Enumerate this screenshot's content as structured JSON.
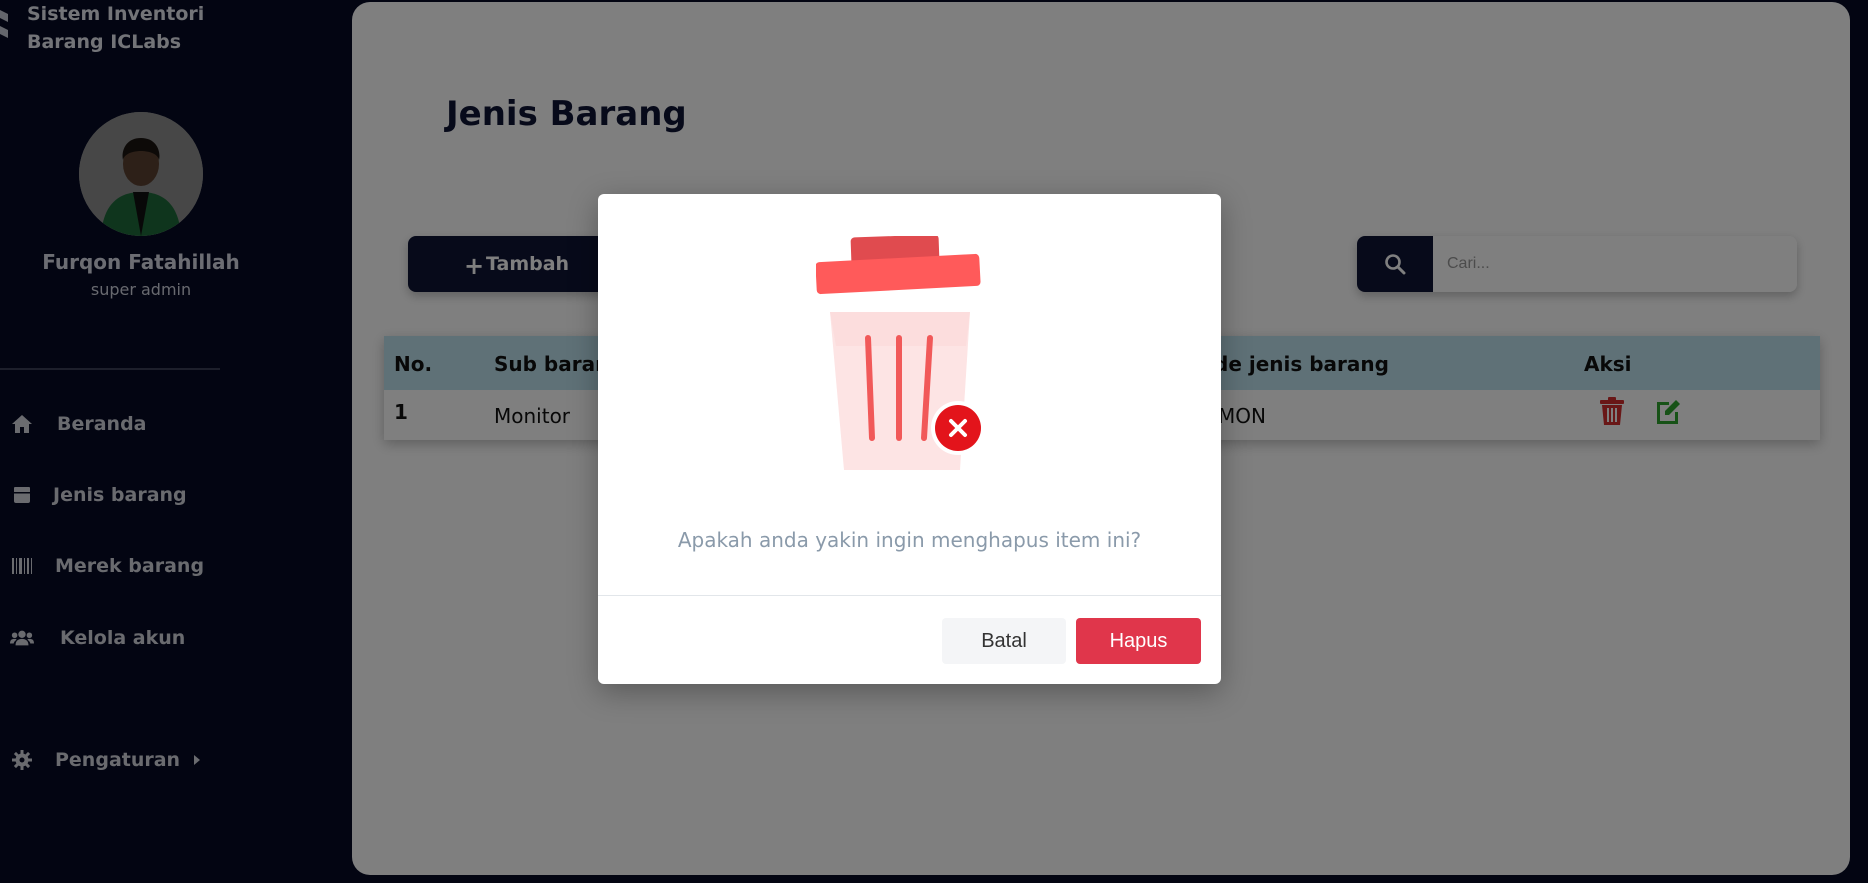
{
  "app": {
    "title_line1": "Sistem Inventori",
    "title_line2": "Barang ICLabs"
  },
  "user": {
    "name": "Furqon Fatahillah",
    "role": "super admin"
  },
  "sidebar": {
    "items": [
      {
        "label": "Beranda",
        "icon": "home-icon"
      },
      {
        "label": "Jenis barang",
        "icon": "box-icon"
      },
      {
        "label": "Merek barang",
        "icon": "barcode-icon"
      },
      {
        "label": "Kelola akun",
        "icon": "users-icon"
      },
      {
        "label": "Pengaturan",
        "icon": "gear-icon"
      }
    ]
  },
  "main": {
    "title": "Jenis Barang",
    "add_label": "Tambah",
    "search_placeholder": "Cari..."
  },
  "table": {
    "headers": [
      "No.",
      "Sub baran",
      "de jenis barang",
      "Aksi"
    ],
    "rows": [
      {
        "no": "1",
        "sub": "Monitor",
        "kode": "MON"
      }
    ]
  },
  "modal": {
    "message": "Apakah anda yakin ingin menghapus item ini?",
    "cancel_label": "Batal",
    "confirm_label": "Hapus"
  },
  "colors": {
    "sidebar_bg": "#060b25",
    "primary": "#0e1435",
    "header_bg": "#bfe3ee",
    "danger": "#e0364b",
    "edit_green": "#2fa52f"
  }
}
